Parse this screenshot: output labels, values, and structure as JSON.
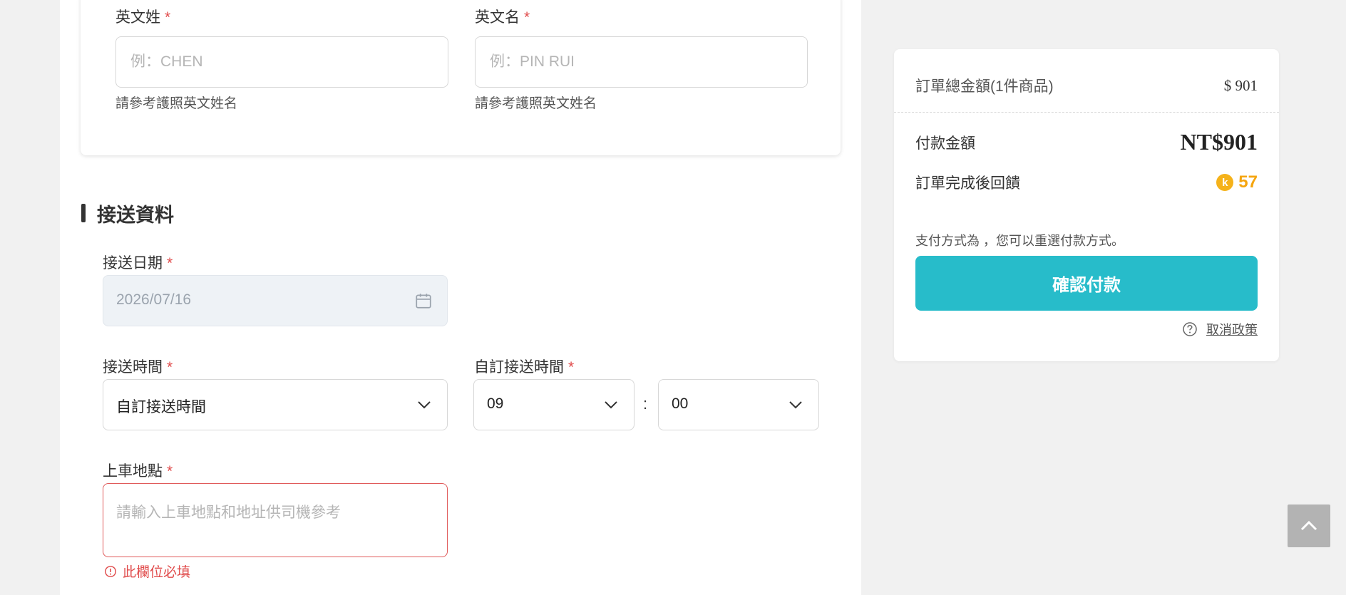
{
  "passenger": {
    "last_name_label": "英文姓",
    "last_name_placeholder": "例：CHEN",
    "last_name_hint": "請參考護照英文姓名",
    "first_name_label": "英文名",
    "first_name_placeholder": "例：PIN RUI",
    "first_name_hint": "請參考護照英文姓名"
  },
  "required_mark": "*",
  "pickup": {
    "section_title": "接送資料",
    "date_label": "接送日期",
    "date_value": "2026/07/16",
    "time_label": "接送時間",
    "time_value": "自訂接送時間",
    "custom_time_label": "自訂接送時間",
    "hour_value": "09",
    "minute_value": "00",
    "time_separator": ":",
    "location_label": "上車地點",
    "location_placeholder": "請輸入上車地點和地址供司機參考",
    "location_error": "此欄位必填"
  },
  "summary": {
    "total_label": "訂單總金額(1件商品)",
    "total_value": "$ 901",
    "payment_label": "付款金額",
    "payment_value": "NT$901",
    "reward_label": "訂單完成後回饋",
    "reward_coin_icon": "k",
    "reward_value": "57",
    "payment_method_note": "支付方式為 ，您可以重選付款方式。",
    "confirm_button": "確認付款",
    "cancel_policy_link": "取消政策"
  },
  "colors": {
    "accent": "#27bcca",
    "error": "#e04b4b",
    "coin": "#f5b21a"
  },
  "icons": {
    "calendar": "calendar-icon",
    "chevron": "chevron-down-icon",
    "error": "error-circle-icon",
    "help": "question-circle-icon",
    "scroll_top": "chevron-up-icon"
  }
}
